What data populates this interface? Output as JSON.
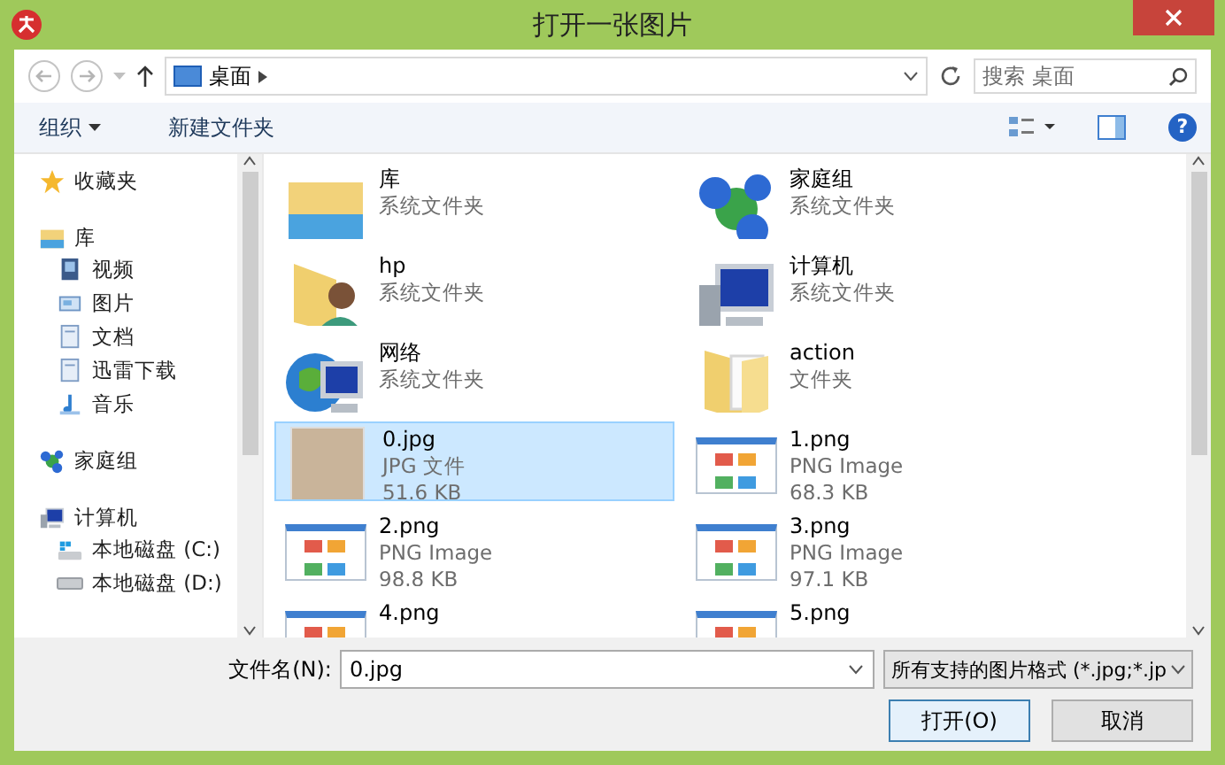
{
  "window": {
    "title": "打开一张图片"
  },
  "address": {
    "path": "桌面"
  },
  "search": {
    "placeholder": "搜索 桌面"
  },
  "toolbar": {
    "organize": "组织",
    "new_folder": "新建文件夹",
    "help": "?"
  },
  "sidebar": {
    "items": [
      {
        "label": "收藏夹",
        "kind": "star"
      },
      {
        "label": "库",
        "kind": "library",
        "children": [
          {
            "label": "视频",
            "kind": "video"
          },
          {
            "label": "图片",
            "kind": "pictures"
          },
          {
            "label": "文档",
            "kind": "documents"
          },
          {
            "label": "迅雷下载",
            "kind": "documents"
          },
          {
            "label": "音乐",
            "kind": "music"
          }
        ]
      },
      {
        "label": "家庭组",
        "kind": "homegroup"
      },
      {
        "label": "计算机",
        "kind": "computer",
        "children": [
          {
            "label": "本地磁盘 (C:)",
            "kind": "system-drive"
          },
          {
            "label": "本地磁盘 (D:)",
            "kind": "drive"
          }
        ]
      }
    ]
  },
  "files": [
    {
      "name": "库",
      "type": "系统文件夹",
      "kind": "library",
      "selected": false
    },
    {
      "name": "家庭组",
      "type": "系统文件夹",
      "kind": "homegroup",
      "selected": false
    },
    {
      "name": "hp",
      "type": "系统文件夹",
      "kind": "user-folder",
      "selected": false
    },
    {
      "name": "计算机",
      "type": "系统文件夹",
      "kind": "computer",
      "selected": false
    },
    {
      "name": "网络",
      "type": "系统文件夹",
      "kind": "network",
      "selected": false
    },
    {
      "name": "action",
      "type": "文件夹",
      "kind": "folder",
      "selected": false
    },
    {
      "name": "0.jpg",
      "type": "JPG 文件",
      "size": "51.6 KB",
      "kind": "photo",
      "selected": true
    },
    {
      "name": "1.png",
      "type": "PNG Image",
      "size": "68.3 KB",
      "kind": "screenshot",
      "selected": false
    },
    {
      "name": "2.png",
      "type": "PNG Image",
      "size": "98.8 KB",
      "kind": "screenshot",
      "selected": false
    },
    {
      "name": "3.png",
      "type": "PNG Image",
      "size": "97.1 KB",
      "kind": "screenshot",
      "selected": false
    },
    {
      "name": "4.png",
      "kind": "screenshot",
      "selected": false
    },
    {
      "name": "5.png",
      "kind": "screenshot",
      "selected": false
    }
  ],
  "footer": {
    "filename_label": "文件名(N):",
    "filename": "0.jpg",
    "filter": "所有支持的图片格式 (*.jpg;*.jp",
    "buttons": [
      {
        "label": "打开(O)",
        "default": true
      },
      {
        "label": "取消",
        "default": false
      }
    ]
  }
}
